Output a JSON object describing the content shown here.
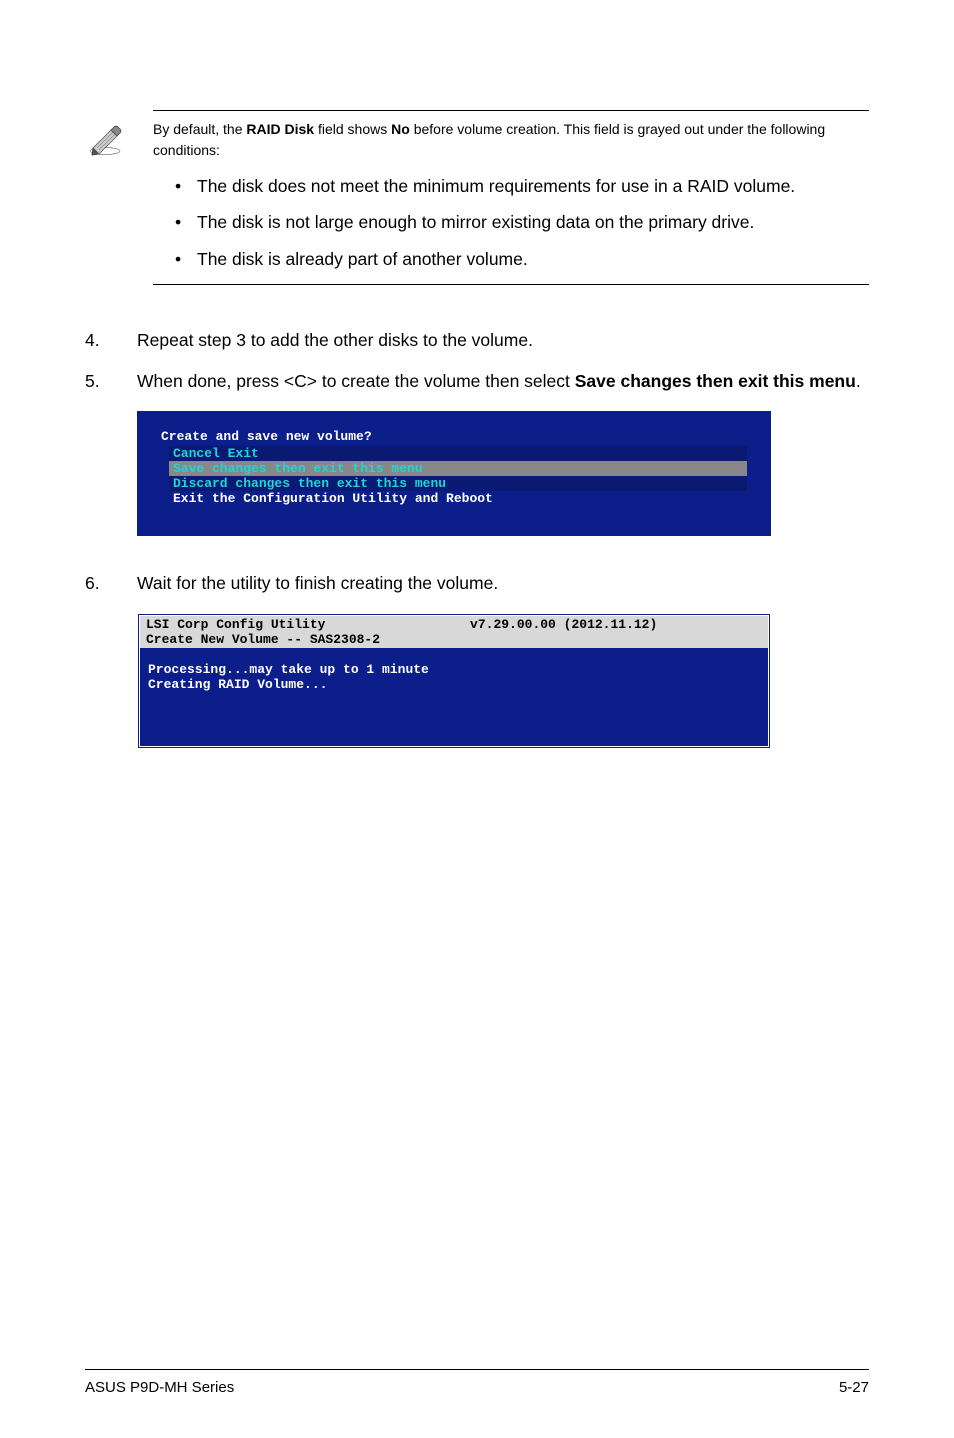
{
  "note": {
    "text_prefix": "By default, the ",
    "bold1": "RAID Disk",
    "text_mid1": " field shows ",
    "bold2": "No",
    "text_suffix": " before volume creation. This field is grayed out under the following conditions:",
    "bullets": [
      "The disk does not meet the minimum requirements for use in a RAID volume.",
      "The disk is not large enough to mirror existing data on the primary drive.",
      "The disk is already part of another volume."
    ]
  },
  "steps": {
    "s4": {
      "num": "4.",
      "text": "Repeat step 3 to add the other disks to the volume."
    },
    "s5": {
      "num": "5.",
      "text_prefix": "When done, press <C> to create the volume then select ",
      "bold": "Save changes then exit this menu",
      "text_suffix": "."
    },
    "s6": {
      "num": "6.",
      "text": "Wait for the utility to finish creating the volume."
    }
  },
  "bios1": {
    "header": "Create and save new volume?",
    "opt1": "Cancel Exit",
    "opt2": "Save changes then exit this menu",
    "opt3": "Discard changes then exit this menu",
    "opt4": "Exit the Configuration Utility and Reboot"
  },
  "bios2": {
    "header_line1": "LSI Corp Config Utility",
    "header_version": "v7.29.00.00 (2012.11.12)",
    "header_line2": "Create New Volume -- SAS2308-2",
    "body_line1": "Processing...may take up to 1 minute",
    "body_line2": "Creating RAID Volume..."
  },
  "footer": {
    "text": "ASUS P9D-MH Series",
    "page": "5-27"
  }
}
